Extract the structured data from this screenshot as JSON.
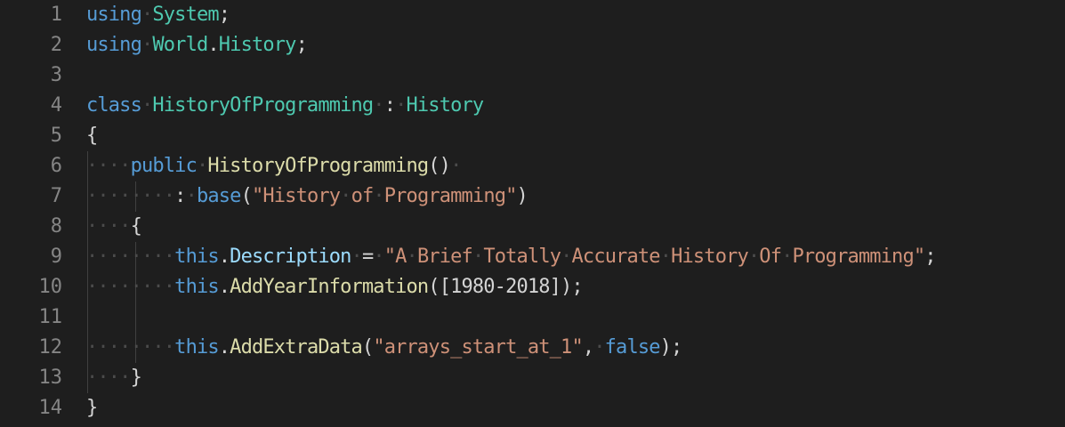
{
  "editor": {
    "line_numbers": [
      "1",
      "2",
      "3",
      "4",
      "5",
      "6",
      "7",
      "8",
      "9",
      "10",
      "11",
      "12",
      "13",
      "14"
    ],
    "lines": [
      [
        {
          "c": "k",
          "t": "using"
        },
        {
          "c": "ws",
          "t": "·"
        },
        {
          "c": "t",
          "t": "System"
        },
        {
          "c": "o",
          "t": ";"
        }
      ],
      [
        {
          "c": "k",
          "t": "using"
        },
        {
          "c": "ws",
          "t": "·"
        },
        {
          "c": "t",
          "t": "World"
        },
        {
          "c": "o",
          "t": "."
        },
        {
          "c": "t",
          "t": "History"
        },
        {
          "c": "o",
          "t": ";"
        }
      ],
      [],
      [
        {
          "c": "k",
          "t": "class"
        },
        {
          "c": "ws",
          "t": "·"
        },
        {
          "c": "t",
          "t": "HistoryOfProgramming"
        },
        {
          "c": "ws",
          "t": "·"
        },
        {
          "c": "o",
          "t": ":"
        },
        {
          "c": "ws",
          "t": "·"
        },
        {
          "c": "t",
          "t": "History"
        }
      ],
      [
        {
          "c": "o",
          "t": "{"
        }
      ],
      [
        {
          "c": "ws",
          "t": "····"
        },
        {
          "c": "k",
          "t": "public"
        },
        {
          "c": "ws",
          "t": "·"
        },
        {
          "c": "f",
          "t": "HistoryOfProgramming"
        },
        {
          "c": "o",
          "t": "()"
        },
        {
          "c": "ws",
          "t": "·"
        }
      ],
      [
        {
          "c": "ws",
          "t": "········"
        },
        {
          "c": "o",
          "t": ":"
        },
        {
          "c": "ws",
          "t": "·"
        },
        {
          "c": "k",
          "t": "base"
        },
        {
          "c": "o",
          "t": "("
        },
        {
          "c": "s",
          "t": "\"History"
        },
        {
          "c": "ws",
          "t": "·"
        },
        {
          "c": "s",
          "t": "of"
        },
        {
          "c": "ws",
          "t": "·"
        },
        {
          "c": "s",
          "t": "Programming\""
        },
        {
          "c": "o",
          "t": ")"
        }
      ],
      [
        {
          "c": "ws",
          "t": "····"
        },
        {
          "c": "o",
          "t": "{"
        }
      ],
      [
        {
          "c": "ws",
          "t": "········"
        },
        {
          "c": "k",
          "t": "this"
        },
        {
          "c": "o",
          "t": "."
        },
        {
          "c": "p",
          "t": "Description"
        },
        {
          "c": "ws",
          "t": "·"
        },
        {
          "c": "o",
          "t": "="
        },
        {
          "c": "ws",
          "t": "·"
        },
        {
          "c": "s",
          "t": "\"A"
        },
        {
          "c": "ws",
          "t": "·"
        },
        {
          "c": "s",
          "t": "Brief"
        },
        {
          "c": "ws",
          "t": "·"
        },
        {
          "c": "s",
          "t": "Totally"
        },
        {
          "c": "ws",
          "t": "·"
        },
        {
          "c": "s",
          "t": "Accurate"
        },
        {
          "c": "ws",
          "t": "·"
        },
        {
          "c": "s",
          "t": "History"
        },
        {
          "c": "ws",
          "t": "·"
        },
        {
          "c": "s",
          "t": "Of"
        },
        {
          "c": "ws",
          "t": "·"
        },
        {
          "c": "s",
          "t": "Programming\""
        },
        {
          "c": "o",
          "t": ";"
        }
      ],
      [
        {
          "c": "ws",
          "t": "········"
        },
        {
          "c": "k",
          "t": "this"
        },
        {
          "c": "o",
          "t": "."
        },
        {
          "c": "f",
          "t": "AddYearInformation"
        },
        {
          "c": "o",
          "t": "([1980-2018]);"
        }
      ],
      [],
      [
        {
          "c": "ws",
          "t": "········"
        },
        {
          "c": "k",
          "t": "this"
        },
        {
          "c": "o",
          "t": "."
        },
        {
          "c": "f",
          "t": "AddExtraData"
        },
        {
          "c": "o",
          "t": "("
        },
        {
          "c": "s",
          "t": "\"arrays_start_at_1\""
        },
        {
          "c": "o",
          "t": ","
        },
        {
          "c": "ws",
          "t": "·"
        },
        {
          "c": "k",
          "t": "false"
        },
        {
          "c": "o",
          "t": ");"
        }
      ],
      [
        {
          "c": "ws",
          "t": "····"
        },
        {
          "c": "o",
          "t": "}"
        }
      ],
      [
        {
          "c": "o",
          "t": "}"
        }
      ]
    ]
  },
  "colors": {
    "background": "#1e1e1e",
    "line_number": "#858585",
    "keyword": "#569cd6",
    "type": "#4ec9b0",
    "function": "#dcdcaa",
    "property": "#9cdcfe",
    "string": "#ce9178",
    "punctuation": "#d4d4d4",
    "whitespace_marker": "#4b4b4b"
  }
}
